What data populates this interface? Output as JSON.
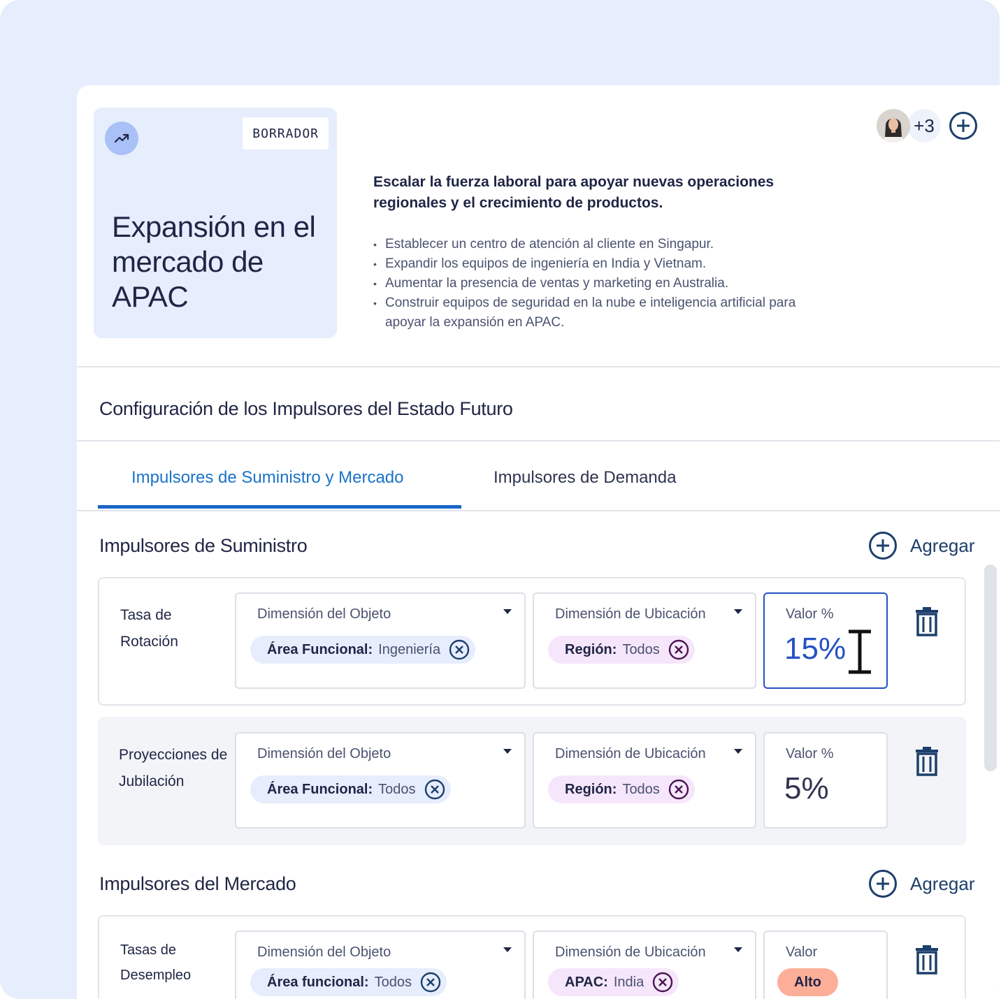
{
  "header": {
    "status_badge": "BORRADOR",
    "title": "Expansión en el mercado de APAC",
    "icon": "trending-up-icon",
    "description_title": "Escalar la fuerza laboral para apoyar nuevas operaciones regionales y el crecimiento de productos.",
    "bullets": [
      "Establecer un centro de atención al cliente en Singapur.",
      "Expandir los equipos de ingeniería en India y Vietnam.",
      "Aumentar la presencia de ventas y marketing en Australia.",
      "Construir equipos de seguridad en la nube e inteligencia artificial para apoyar la expansión en APAC."
    ],
    "collaborators_more": "+3"
  },
  "config": {
    "title": "Configuración de los Impulsores del Estado Futuro",
    "tabs": [
      {
        "label": "Impulsores de Suministro y Mercado",
        "active": true
      },
      {
        "label": "Impulsores de Demanda",
        "active": false
      }
    ]
  },
  "supply": {
    "title": "Impulsores de Suministro",
    "add_label": "Agregar",
    "rows": [
      {
        "label": "Tasa de Rotación",
        "object_label": "Dimensión del Objeto",
        "object_chip_key": "Área Funcional:",
        "object_chip_value": "Ingeniería",
        "location_label": "Dimensión de Ubicación",
        "location_chip_key": "Región:",
        "location_chip_value": "Todos",
        "value_label": "Valor %",
        "value": "15%"
      },
      {
        "label": "Proyecciones de Jubilación",
        "object_label": "Dimensión del Objeto",
        "object_chip_key": "Área Funcional:",
        "object_chip_value": "Todos",
        "location_label": "Dimensión de Ubicación",
        "location_chip_key": "Región:",
        "location_chip_value": "Todos",
        "value_label": "Valor %",
        "value": "5%"
      }
    ]
  },
  "market": {
    "title": "Impulsores del Mercado",
    "add_label": "Agregar",
    "rows": [
      {
        "label": "Tasas de Desempleo",
        "object_label": "Dimensión del Objeto",
        "object_chip_key": "Área funcional:",
        "object_chip_value": "Todos",
        "location_label": "Dimensión de Ubicación",
        "location_chip_key": "APAC:",
        "location_chip_value": "India",
        "value_label": "Valor",
        "value": "Alto"
      }
    ]
  },
  "colors": {
    "accent": "#1a73c8",
    "focus": "#2451c4",
    "chip_blue": "#e6edfd",
    "chip_pink": "#f6e6fb",
    "alto": "#fcae98"
  }
}
